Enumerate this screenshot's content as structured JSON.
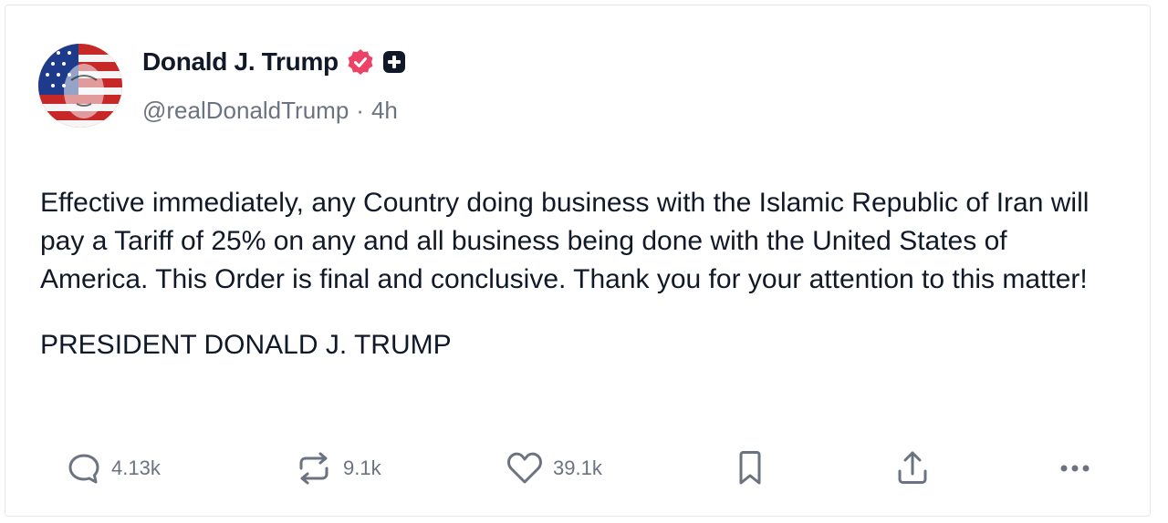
{
  "post": {
    "author": {
      "display_name": "Donald J. Trump",
      "handle": "@realDonaldTrump",
      "separator": "·",
      "time": "4h",
      "verified_badge": "verified-check-icon",
      "plus_badge": "plus-badge-icon"
    },
    "body": "Effective immediately, any Country doing business with the Islamic Republic of Iran will pay a Tariff of 25% on any and all business being done with the United States of America. This Order is final and conclusive. Thank you for your attention to this matter!",
    "signature": "PRESIDENT DONALD J. TRUMP"
  },
  "actions": {
    "replies": "4.13k",
    "reposts": "9.1k",
    "likes": "39.1k"
  },
  "colors": {
    "verified": "#ec4266",
    "text": "#111827",
    "muted": "#6b7280"
  }
}
